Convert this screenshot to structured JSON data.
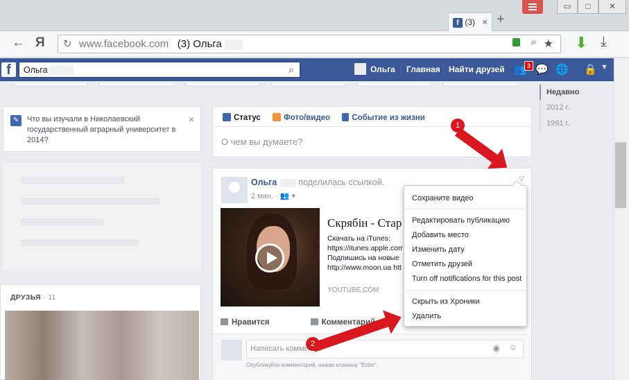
{
  "browser": {
    "tab_title": "(3)",
    "new_tab": "+",
    "domain": "www.facebook.com",
    "page_title": "(3) Ольга",
    "back_icon": "←",
    "yandex_logo": "Я",
    "reload_icon": "↻",
    "min": "▭",
    "max": "□",
    "close": "✕"
  },
  "fb": {
    "search_value": "Ольга",
    "user": "Ольга",
    "home": "Главная",
    "find_friends": "Найти друзей",
    "badge": "3"
  },
  "education": {
    "text": "Что вы изучали в Николаевский государственный аграрный университет в 2014?",
    "close": "×"
  },
  "friends": {
    "label": "ДРУЗЬЯ",
    "sep": " · ",
    "count": "11"
  },
  "composer": {
    "status": "Статус",
    "photo": "Фото/видео",
    "event": "Событие из жизни",
    "placeholder": "О чем вы думаете?"
  },
  "post": {
    "author": "Ольга",
    "action": "поделилась ссылкой.",
    "time": "2 мин.",
    "link_title": "Скрябін - Стар",
    "link_desc": [
      "Скачать на iTunes:",
      "https://itunes.apple.com",
      "Подпишись на новые",
      "http://www.moon.ua htt"
    ],
    "source": "YOUTUBE.COM",
    "like": "Нравится",
    "comment": "Комментарий",
    "comment_placeholder": "Написать коммент...",
    "comment_hint": "Опубликуйте комментарий, нажав клавишу \"Enter\"."
  },
  "menu": {
    "items": [
      "Сохраните видео",
      "Редактировать публикацию",
      "Добавить место",
      "Изменить дату",
      "Отметить друзей",
      "Turn off notifications for this post",
      "Скрыть из Хроники",
      "Удалить"
    ]
  },
  "timeline": {
    "years": [
      "Недавно",
      "2012 г.",
      "1991 г."
    ]
  },
  "annotations": {
    "one": "1",
    "two": "2"
  },
  "colors": {
    "fb_blue": "#3b5998",
    "link": "#365899",
    "arrow": "#d9171e"
  }
}
